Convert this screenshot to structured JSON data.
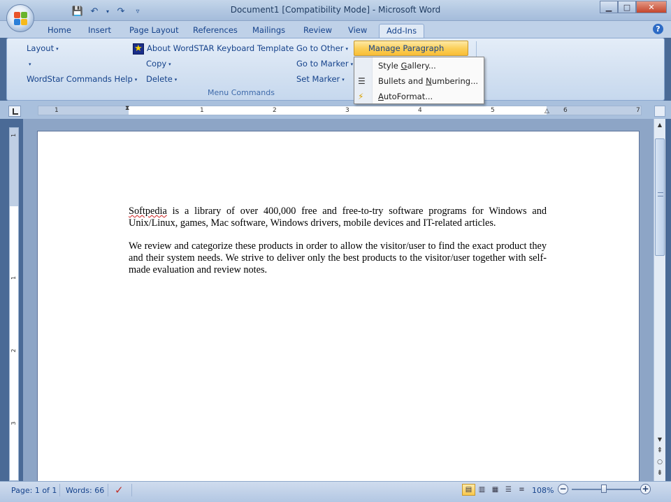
{
  "window": {
    "title": "Document1 [Compatibility Mode] - Microsoft Word",
    "minimize_glyph": "▁",
    "maximize_glyph": "□",
    "close_glyph": "✕"
  },
  "qat": {
    "save_glyph": "💾",
    "undo_glyph": "↶",
    "undo_drop_glyph": "▾",
    "redo_glyph": "↷",
    "customize_glyph": "▿"
  },
  "ribbon_tabs": [
    "Home",
    "Insert",
    "Page Layout",
    "References",
    "Mailings",
    "Review",
    "View",
    "Add-Ins"
  ],
  "active_tab": "Add-Ins",
  "help_glyph": "?",
  "ribbon": {
    "layout": "Layout",
    "blank_dropdown": "",
    "wordstar_help": "WordStar Commands Help",
    "about": "About WordSTAR Keyboard Template",
    "copy": "Copy",
    "delete": "Delete",
    "go_to_other": "Go to Other",
    "go_to_marker": "Go to Marker",
    "set_marker": "Set Marker",
    "manage_styles": "Manage Paragraph Styles",
    "group_label": "Menu Commands",
    "arrow": "▾"
  },
  "dropdown_menu": {
    "items": [
      {
        "label_pre": "Style ",
        "accel": "G",
        "label_post": "allery...",
        "icon": "style-gallery-icon",
        "glyph": ""
      },
      {
        "label_pre": "Bullets and ",
        "accel": "N",
        "label_post": "umbering...",
        "icon": "bullets-numbering-icon",
        "glyph": "☰"
      },
      {
        "label_pre": "",
        "accel": "A",
        "label_post": "utoFormat...",
        "icon": "autoformat-icon",
        "glyph": "⚡"
      }
    ]
  },
  "ruler": {
    "numbers": [
      "1",
      "1",
      "2",
      "3",
      "4",
      "5",
      "6",
      "7"
    ],
    "vertical_numbers": [
      "1",
      "1",
      "2",
      "3"
    ]
  },
  "document": {
    "paragraph1_word": "Softpedia",
    "paragraph1_rest": " is a library of over 400,000 free and free-to-try software programs for Windows and Unix/Linux, games, Mac software, Windows drivers, mobile devices and IT-related articles.",
    "paragraph2": "We review and categorize these products in order to allow the visitor/user to find the exact product they and their system needs. We strive to deliver only the best products to the visitor/user together with self-made evaluation and review notes."
  },
  "scrollbar": {
    "up_glyph": "▲",
    "down_glyph": "▼",
    "prev_page_glyph": "⇞",
    "browse_glyph": "○",
    "next_page_glyph": "⇟"
  },
  "statusbar": {
    "page": "Page: 1 of 1",
    "words": "Words: 66",
    "proofing_glyph": "✓",
    "zoom": "108%",
    "zoom_out_glyph": "−",
    "zoom_in_glyph": "+",
    "view_glyphs": [
      "▤",
      "▥",
      "▦",
      "☰",
      "≡"
    ]
  }
}
